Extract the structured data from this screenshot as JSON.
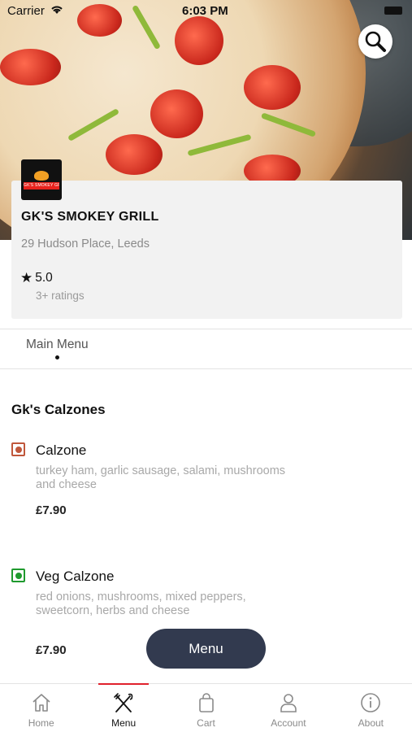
{
  "status_bar": {
    "carrier": "Carrier",
    "time": "6:03 PM"
  },
  "restaurant": {
    "logo_text": "GK'S SMOKEY GRILL",
    "name": "GK'S SMOKEY GRILL",
    "address": "29 Hudson Place, Leeds",
    "rating": "5.0",
    "rating_count": "3+ ratings"
  },
  "tabs": [
    {
      "label": "Main Menu",
      "active": true
    }
  ],
  "menu": {
    "section_title": "Gk's Calzones",
    "items": [
      {
        "name": "Calzone",
        "description": "turkey ham, garlic sausage, salami, mushrooms and cheese",
        "price": "£7.90",
        "veg": false,
        "mark_color": "#c0573b"
      },
      {
        "name": "Veg Calzone",
        "description": "red onions, mushrooms, mixed peppers, sweetcorn, herbs and cheese",
        "price": "£7.90",
        "veg": true,
        "mark_color": "#1f9a2e"
      }
    ]
  },
  "menu_button_label": "Menu",
  "bottom_nav": [
    {
      "label": "Home",
      "icon": "home-icon"
    },
    {
      "label": "Menu",
      "icon": "fork-knife-icon",
      "active": true
    },
    {
      "label": "Cart",
      "icon": "bag-icon"
    },
    {
      "label": "Account",
      "icon": "person-icon"
    },
    {
      "label": "About",
      "icon": "info-icon"
    }
  ],
  "colors": {
    "accent": "#e0212c",
    "fab": "#323a4f",
    "veg": "#1f9a2e",
    "non_veg": "#c0573b"
  }
}
